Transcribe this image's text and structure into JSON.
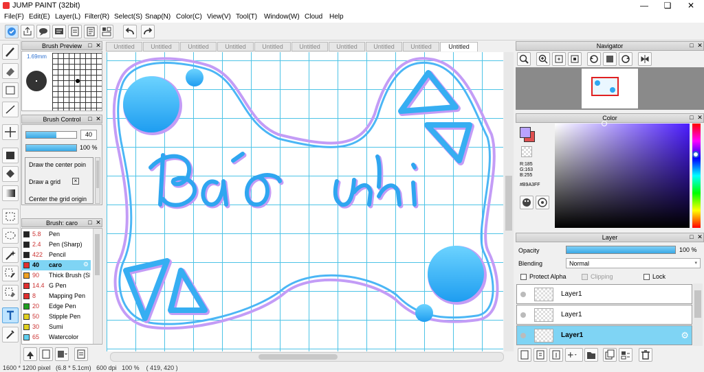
{
  "window": {
    "title": "JUMP PAINT (32bit)",
    "minimize": "—",
    "restore": "❏",
    "close": "✕"
  },
  "menu": [
    "File(F)",
    "Edit(E)",
    "Layer(L)",
    "Filter(R)",
    "Select(S)",
    "Snap(N)",
    "Color(C)",
    "View(V)",
    "Tool(T)",
    "Window(W)",
    "Cloud",
    "Help"
  ],
  "brush_preview": {
    "title": "Brush Preview",
    "size": "1.69mm"
  },
  "brush_control": {
    "title": "Brush Control",
    "size_value": "40",
    "opacity_value": "100 %",
    "size_fill": 0.6,
    "opacity_fill": 1.0,
    "options": [
      "Draw the center poin",
      "Draw a grid",
      "Center the grid origin"
    ]
  },
  "brush_list": {
    "title": "Brush: caro",
    "items": [
      {
        "color": "#222222",
        "size": "5.8",
        "name": "Pen"
      },
      {
        "color": "#222222",
        "size": "2.4",
        "name": "Pen (Sharp)"
      },
      {
        "color": "#222222",
        "size": "422",
        "name": "Pencil"
      },
      {
        "color": "#e03030",
        "size": "40",
        "name": "caro",
        "selected": true
      },
      {
        "color": "#f0a020",
        "size": "90",
        "name": "Thick Brush (Sh"
      },
      {
        "color": "#e03030",
        "size": "14.4",
        "name": "G Pen"
      },
      {
        "color": "#e03030",
        "size": "8",
        "name": "Mapping Pen"
      },
      {
        "color": "#20a020",
        "size": "20",
        "name": "Edge Pen"
      },
      {
        "color": "#e0d020",
        "size": "50",
        "name": "Stipple Pen"
      },
      {
        "color": "#e0d020",
        "size": "30",
        "name": "Sumi"
      },
      {
        "color": "#60d0f0",
        "size": "65",
        "name": "Watercolor"
      }
    ]
  },
  "tabs": [
    "Untitled",
    "Untitled",
    "Untitled",
    "Untitled",
    "Untitled",
    "Untitled",
    "Untitled",
    "Untitled",
    "Untitled",
    "Untitled"
  ],
  "navigator": {
    "title": "Navigator"
  },
  "color": {
    "title": "Color",
    "r": "R:185",
    "g": "G:163",
    "b": "B:255",
    "hex": "#B9A3FF",
    "main": "#B9A3FF",
    "sub": "#E05050"
  },
  "layer": {
    "title": "Layer",
    "opacity_label": "Opacity",
    "opacity_value": "100 %",
    "opacity_fill": 1.0,
    "blending_label": "Blending",
    "blending_value": "Normal",
    "protect_alpha": "Protect Alpha",
    "clipping": "Clipping",
    "lock": "Lock",
    "layers": [
      {
        "name": "Layer1",
        "selected": false
      },
      {
        "name": "Layer1",
        "selected": false
      },
      {
        "name": "Layer1",
        "selected": true
      }
    ]
  },
  "status": {
    "text": "1600 * 1200 pixel   (6.8 * 5.1cm)   600 dpi   100 %    ( 419, 420 )"
  }
}
